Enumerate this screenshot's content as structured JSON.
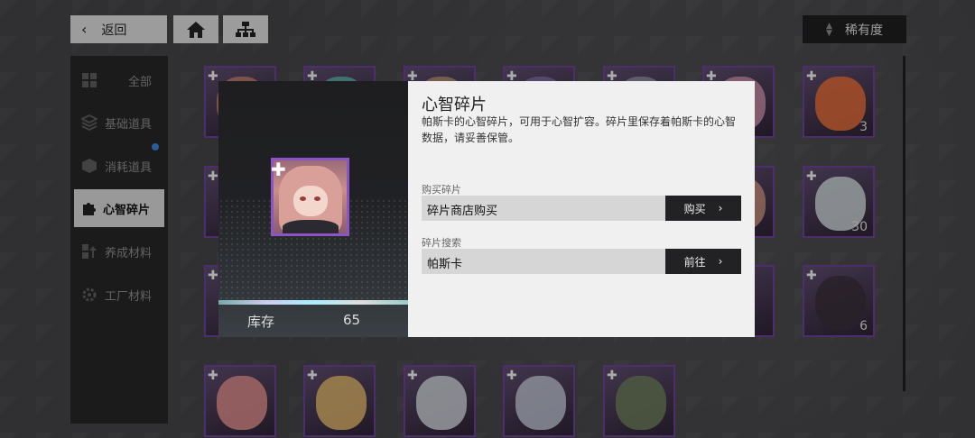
{
  "topbar": {
    "back_label": "返回",
    "sort_label": "稀有度"
  },
  "sidebar": {
    "items": [
      {
        "label": "全部",
        "icon": "grid-icon"
      },
      {
        "label": "基础道具",
        "icon": "layers-icon"
      },
      {
        "label": "消耗道具",
        "icon": "box-icon"
      },
      {
        "label": "心智碎片",
        "icon": "puzzle-icon"
      },
      {
        "label": "养成材料",
        "icon": "upgrade-icon"
      },
      {
        "label": "工厂材料",
        "icon": "gear-icon"
      }
    ],
    "active": "心智碎片"
  },
  "grid": {
    "counts": [
      "3",
      "30",
      "6"
    ]
  },
  "popup": {
    "stock_label": "库存",
    "stock_value": "65",
    "title": "心智碎片",
    "description": "帕斯卡的心智碎片，可用于心智扩容。碎片里保存着帕斯卡的心智数据，请妥善保管。",
    "buy": {
      "section_label": "购买碎片",
      "text": "碎片商店购买",
      "button": "购买"
    },
    "search": {
      "section_label": "碎片搜索",
      "text": "帕斯卡",
      "button": "前往"
    }
  }
}
